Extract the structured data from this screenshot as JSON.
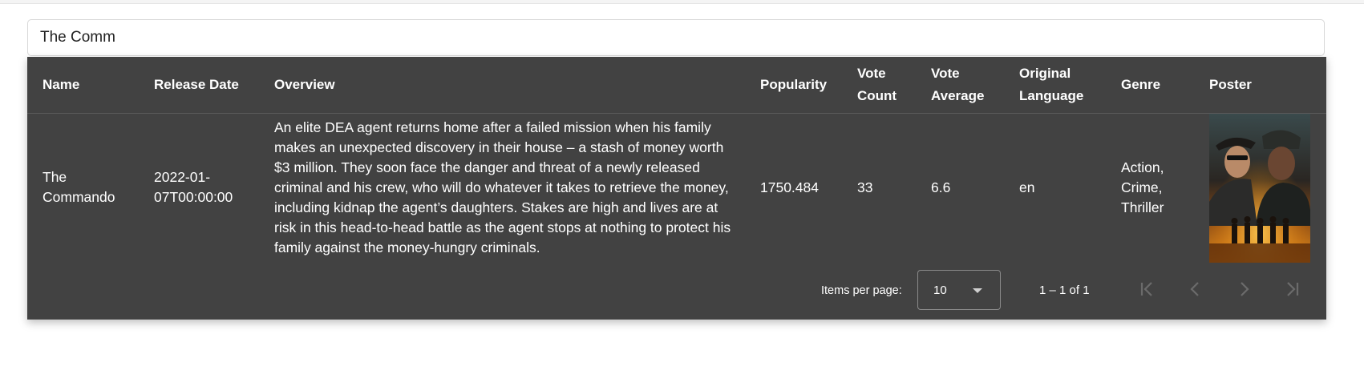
{
  "search": {
    "value": "The Comm"
  },
  "table": {
    "headers": {
      "name": "Name",
      "release_date": "Release Date",
      "overview": "Overview",
      "popularity": "Popularity",
      "vote_count": [
        "Vote",
        "Count"
      ],
      "vote_average": [
        "Vote",
        "Average"
      ],
      "original_language": [
        "Original",
        "Language"
      ],
      "genre": "Genre",
      "poster": "Poster"
    },
    "rows": [
      {
        "name": [
          "The",
          "Commando"
        ],
        "release_date": [
          "2022-01-",
          "07T00:00:00"
        ],
        "overview": "An elite DEA agent returns home after a failed mission when his family makes an unexpected discovery in their house – a stash of money worth $3 million. They soon face the danger and threat of a newly released criminal and his crew, who will do whatever it takes to retrieve the money, including kidnap the agent’s daughters. Stakes are high and lives are at risk in this head-to-head battle as the agent stops at nothing to protect his family against the money-hungry criminals.",
        "popularity": "1750.484",
        "vote_count": "33",
        "vote_average": "6.6",
        "original_language": "en",
        "genre": [
          "Action,",
          "Crime,",
          "Thriller"
        ]
      }
    ]
  },
  "paginator": {
    "items_per_page_label": "Items per page:",
    "items_per_page_value": "10",
    "range_label": "1 – 1 of 1"
  },
  "colors": {
    "table_bg": "#424242",
    "text": "#ffffff",
    "disabled_icon": "#6b6b6b"
  }
}
